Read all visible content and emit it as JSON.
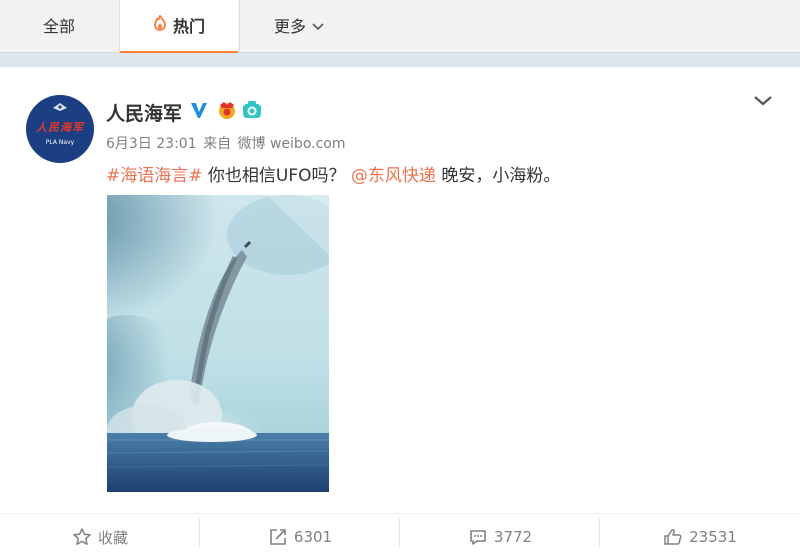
{
  "tabs": {
    "all": "全部",
    "hot": "热门",
    "more": "更多"
  },
  "post": {
    "avatar_brand": "人民海军",
    "avatar_sub": "PLA Navy",
    "username": "人民海军",
    "date": "6月3日 23:01",
    "source_prefix": "来自",
    "source": "微博 weibo.com",
    "hashtag": "#海语海言#",
    "text_middle": " 你也相信UFO吗？",
    "mention": "@东风快递",
    "text_end": " 晚安，小海粉。"
  },
  "actions": {
    "favorite": "收藏",
    "repost": "6301",
    "comment": "3772",
    "like": "23531"
  },
  "colors": {
    "accent": "#fa7d3c",
    "link": "#eb7350",
    "verified": "#1d8fe1"
  }
}
